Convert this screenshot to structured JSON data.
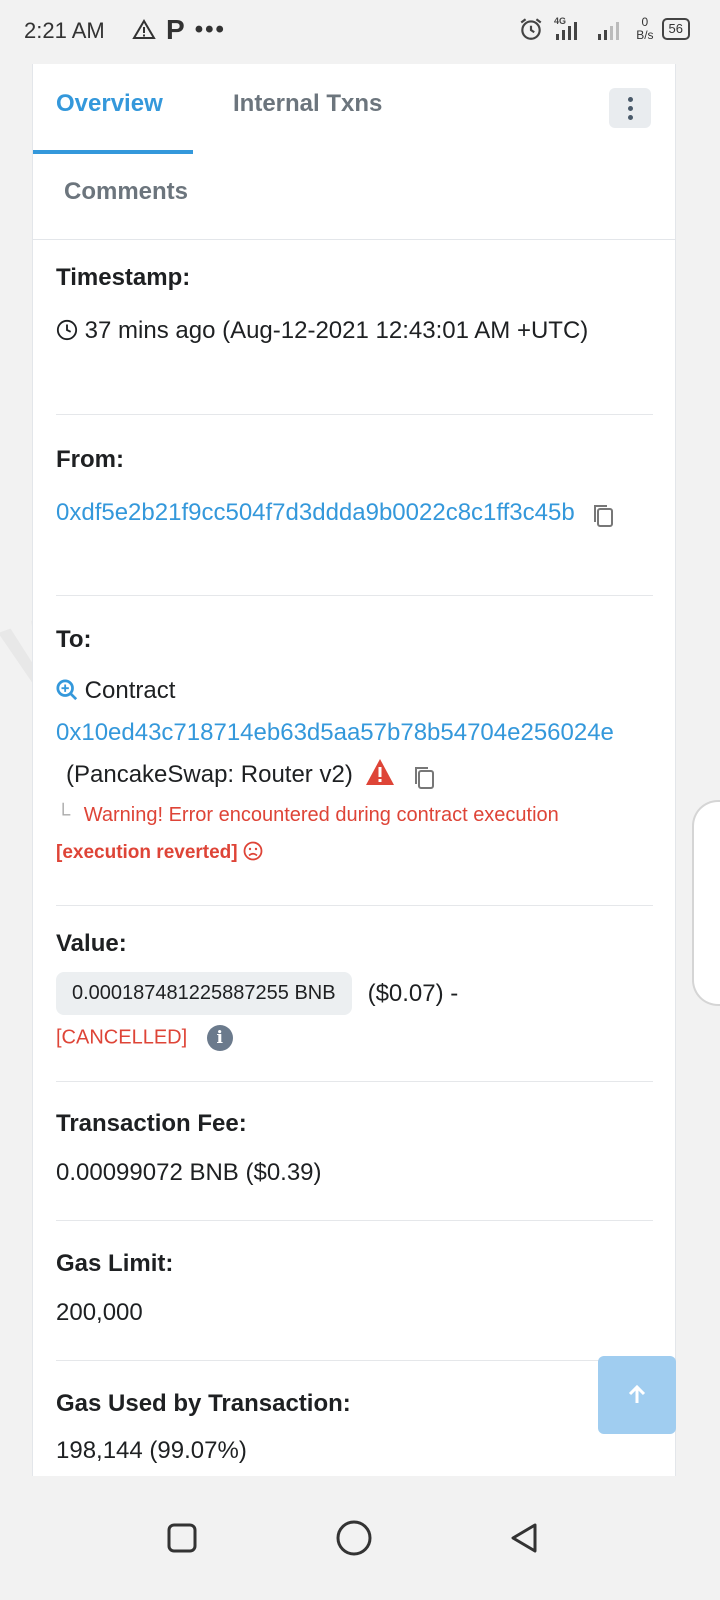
{
  "status_bar": {
    "time": "2:21 AM",
    "network": "4G",
    "rate_value": "0",
    "rate_unit": "B/s",
    "battery": "56"
  },
  "tabs": {
    "overview": "Overview",
    "internal": "Internal Txns",
    "comments": "Comments"
  },
  "timestamp": {
    "label": "Timestamp:",
    "value": "37 mins ago (Aug-12-2021 12:43:01 AM +UTC)"
  },
  "from": {
    "label": "From:",
    "address": "0xdf5e2b21f9cc504f7d3ddda9b0022c8c1ff3c45b"
  },
  "to": {
    "label": "To:",
    "contract_label": "Contract",
    "address": "0x10ed43c718714eb63d5aa57b78b54704e256024e",
    "name": "(PancakeSwap: Router v2)",
    "warning": "Warning! Error encountered during contract execution",
    "reverted": "[execution reverted]"
  },
  "value": {
    "label": "Value:",
    "amount": "0.000187481225887255 BNB",
    "usd": "($0.07) -",
    "status": "[CANCELLED]"
  },
  "fee": {
    "label": "Transaction Fee:",
    "value": "0.00099072 BNB ($0.39)"
  },
  "gas_limit": {
    "label": "Gas Limit:",
    "value": "200,000"
  },
  "gas_used": {
    "label": "Gas Used by Transaction:",
    "value": "198,144 (99.07%)"
  },
  "watermark": "WikiBit",
  "colors": {
    "link": "#3498db",
    "error": "#de4437",
    "scroll_button": "#a0cdf0"
  }
}
